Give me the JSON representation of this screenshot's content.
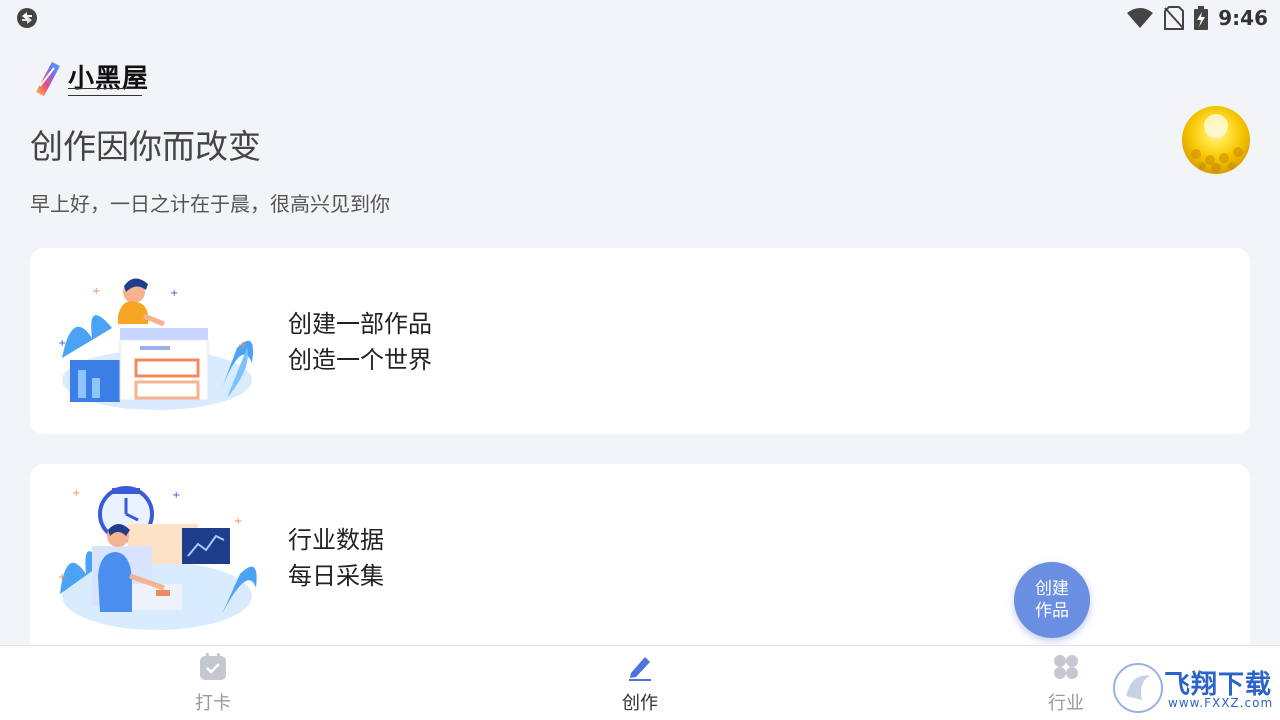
{
  "status_bar": {
    "time": "9:46",
    "left_icon": "sync-icon",
    "right_icons": [
      "wifi-icon",
      "no-sim-icon",
      "battery-charging-icon"
    ]
  },
  "header": {
    "logo_text": "小黑屋",
    "title": "创作因你而改变",
    "greeting": "早上好，一日之计在于晨，很高兴见到你"
  },
  "cards": [
    {
      "line1": "创建一部作品",
      "line2": "创造一个世界",
      "illustration": "writer-illustration"
    },
    {
      "line1": "行业数据",
      "line2": "每日采集",
      "illustration": "data-illustration"
    }
  ],
  "fab": {
    "line1": "创建",
    "line2": "作品"
  },
  "bottom_nav": [
    {
      "label": "打卡",
      "icon": "checkin-icon",
      "active": false
    },
    {
      "label": "创作",
      "icon": "pen-icon",
      "active": true
    },
    {
      "label": "行业",
      "icon": "grid-icon",
      "active": false
    }
  ],
  "watermark": {
    "text": "飞翔下载",
    "url": "www.FXXZ.com"
  },
  "colors": {
    "accent": "#6a8fe2",
    "background": "#f3f4f8",
    "card": "#ffffff",
    "nav_inactive": "#999999"
  }
}
